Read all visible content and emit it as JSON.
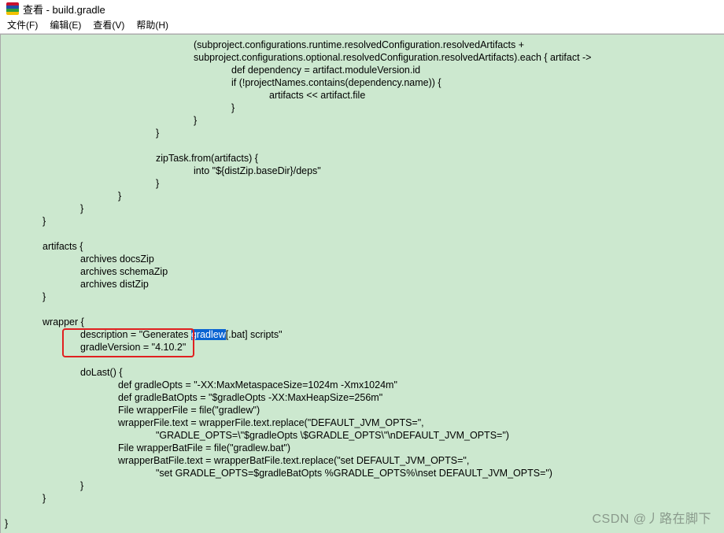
{
  "window": {
    "title": "查看 - build.gradle",
    "icon": "winrar-books-icon",
    "icon_colors": [
      "#c8102e",
      "#1f4fa8",
      "#2e9e3e",
      "#f2c200"
    ]
  },
  "menubar": {
    "items": [
      "文件(F)",
      "编辑(E)",
      "查看(V)",
      "帮助(H)"
    ]
  },
  "editor": {
    "background": "#cce8cf",
    "lines": [
      "(subproject.configurations.runtime.resolvedConfiguration.resolvedArtifacts +",
      "subproject.configurations.optional.resolvedConfiguration.resolvedArtifacts).each { artifact ->",
      "def dependency = artifact.moduleVersion.id",
      "if (!projectNames.contains(dependency.name)) {",
      "artifacts << artifact.file",
      "}",
      "}",
      "}",
      "",
      "zipTask.from(artifacts) {",
      "into \"${distZip.baseDir}/deps\"",
      "}",
      "}",
      "}",
      "}",
      "",
      "artifacts {",
      "archives docsZip",
      "archives schemaZip",
      "archives distZip",
      "}",
      "",
      "wrapper {",
      "description = \"Generates ",
      "gradleVersion = \"4.10.2\"",
      "",
      "doLast() {",
      "def gradleOpts = \"-XX:MaxMetaspaceSize=1024m -Xmx1024m\"",
      "def gradleBatOpts = \"$gradleOpts -XX:MaxHeapSize=256m\"",
      "File wrapperFile = file(\"gradlew\")",
      "wrapperFile.text = wrapperFile.text.replace(\"DEFAULT_JVM_OPTS=\",",
      "\"GRADLE_OPTS=\\\"$gradleOpts \\$GRADLE_OPTS\\\"\\nDEFAULT_JVM_OPTS=\")",
      "File wrapperBatFile = file(\"gradlew.bat\")",
      "wrapperBatFile.text = wrapperBatFile.text.replace(\"set DEFAULT_JVM_OPTS=\",",
      "\"set GRADLE_OPTS=$gradleBatOpts %GRADLE_OPTS%\\nset DEFAULT_JVM_OPTS=\")",
      "}",
      "}",
      "",
      "}"
    ],
    "selection": {
      "selected_text": "gradlew",
      "after_text": "[.bat] scripts\""
    }
  },
  "watermark": "CSDN @丿路在脚下"
}
